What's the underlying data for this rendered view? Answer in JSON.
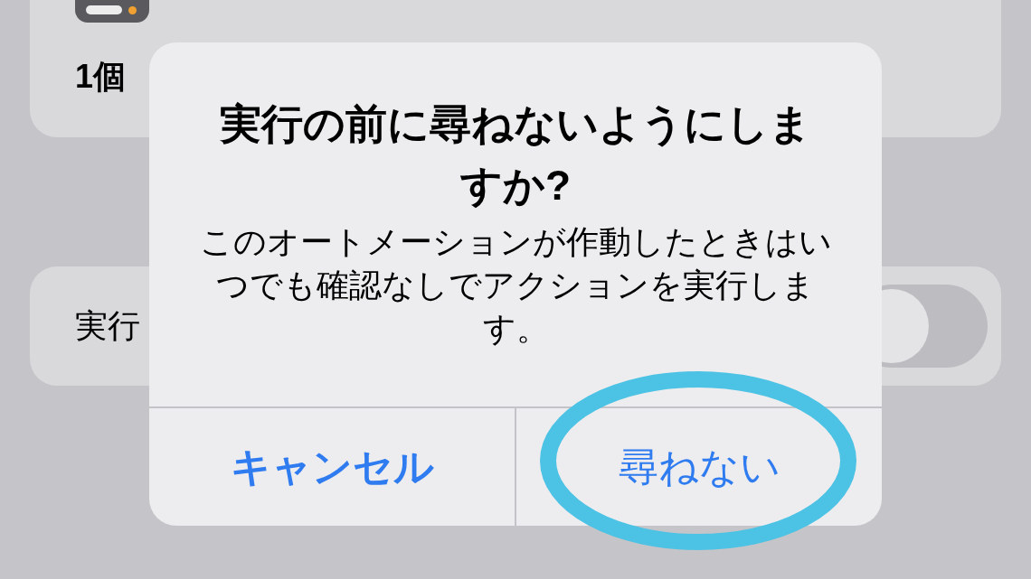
{
  "background": {
    "cards": [
      {
        "kind": "summary",
        "text": "1個"
      },
      {
        "kind": "toggle_row",
        "label": "実行",
        "on": false
      }
    ]
  },
  "alert": {
    "title": "実行の前に尋ねないようにしますか?",
    "message": "このオートメーションが作動したときはいつでも確認なしでアクションを実行します。",
    "buttons": [
      {
        "label": "キャンセル",
        "kind": "cancel"
      },
      {
        "label": "尋ねない",
        "kind": "default"
      }
    ]
  }
}
